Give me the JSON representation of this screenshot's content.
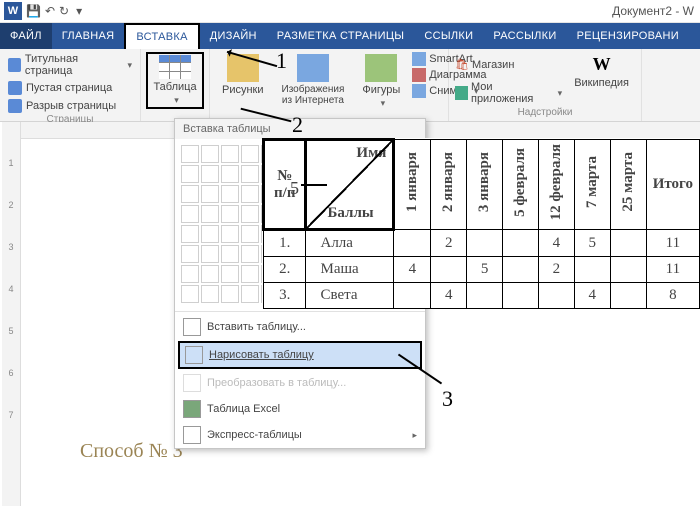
{
  "titlebar": {
    "doc": "Документ2 - W"
  },
  "tabs": {
    "file": "ФАЙЛ",
    "home": "ГЛАВНАЯ",
    "insert": "ВСТАВКА",
    "design": "ДИЗАЙН",
    "layout": "РАЗМЕТКА СТРАНИЦЫ",
    "refs": "ССЫЛКИ",
    "mail": "РАССЫЛКИ",
    "review": "РЕЦЕНЗИРОВАНИ"
  },
  "groups": {
    "pages": {
      "label": "Страницы",
      "cover": "Титульная страница",
      "blank": "Пустая страница",
      "break": "Разрыв страницы"
    },
    "tables": {
      "btn": "Таблица"
    },
    "illus": {
      "pic": "Рисунки",
      "online": "Изображения из Интернета",
      "shapes": "Фигуры",
      "smartart": "SmartArt",
      "chart": "Диаграмма",
      "snip": "Снимок"
    },
    "addins": {
      "label": "Надстройки",
      "store": "Магазин",
      "my": "Мои приложения",
      "wiki": "Википедия"
    }
  },
  "dropdown": {
    "head": "Вставка таблицы",
    "insert": "Вставить таблицу...",
    "draw": "Нарисовать таблицу",
    "convert": "Преобразовать в таблицу...",
    "excel": "Таблица Excel",
    "quick": "Экспресс-таблицы"
  },
  "table": {
    "corner": {
      "npp": "№ п/п",
      "top": "Имя",
      "bot": "Баллы"
    },
    "cols": [
      "1 января",
      "2 января",
      "3 января",
      "5 февраля",
      "12 февраля",
      "7 марта",
      "25 марта"
    ],
    "total": "Итого",
    "rows": [
      {
        "n": "1.",
        "name": "Алла",
        "v": [
          "",
          "2",
          "",
          "",
          "4",
          "5"
        ],
        "t": "11"
      },
      {
        "n": "2.",
        "name": "Маша",
        "v": [
          "4",
          "",
          "5",
          "",
          "2",
          ""
        ],
        "t": "11"
      },
      {
        "n": "3.",
        "name": "Света",
        "v": [
          "",
          "4",
          "",
          "",
          "",
          "4"
        ],
        "t": "8"
      }
    ]
  },
  "ann": {
    "a1": "1",
    "a2": "2",
    "a3": "3",
    "a5": "5"
  },
  "caption": "Способ № 3",
  "ruler": [
    "",
    "1",
    "2",
    "3",
    "4",
    "5",
    "6",
    "7"
  ]
}
